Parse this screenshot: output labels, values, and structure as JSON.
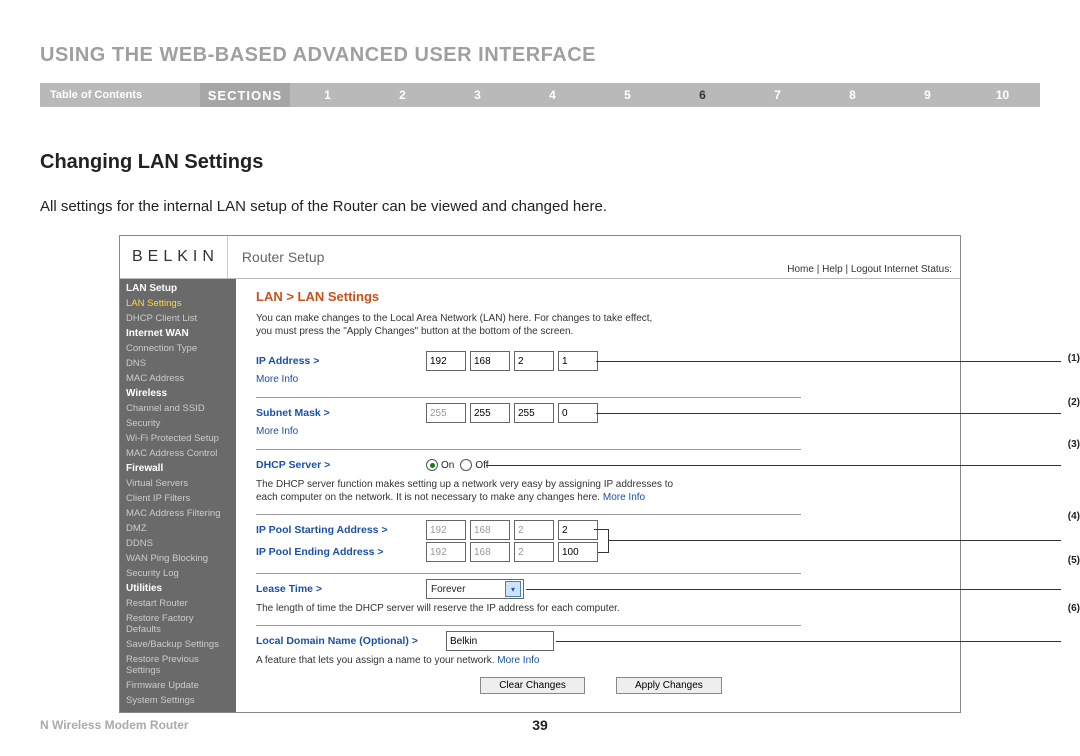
{
  "header": {
    "title": "USING THE WEB-BASED ADVANCED USER INTERFACE",
    "toc": "Table of Contents",
    "sections_label": "SECTIONS",
    "sections": [
      "1",
      "2",
      "3",
      "4",
      "5",
      "6",
      "7",
      "8",
      "9",
      "10"
    ],
    "active_section": "6"
  },
  "subhead": "Changing LAN Settings",
  "body_text": "All settings for the internal LAN setup of the Router can be viewed and changed here.",
  "ss": {
    "logo": "BELKIN",
    "router_setup": "Router Setup",
    "toplinks": "Home | Help | Logout   Internet Status:",
    "sidebar": [
      {
        "label": "LAN Setup",
        "type": "cat"
      },
      {
        "label": "LAN Settings",
        "type": "item",
        "active": true
      },
      {
        "label": "DHCP Client List",
        "type": "item"
      },
      {
        "label": "Internet WAN",
        "type": "cat"
      },
      {
        "label": "Connection Type",
        "type": "item"
      },
      {
        "label": "DNS",
        "type": "item"
      },
      {
        "label": "MAC Address",
        "type": "item"
      },
      {
        "label": "Wireless",
        "type": "cat"
      },
      {
        "label": "Channel and SSID",
        "type": "item"
      },
      {
        "label": "Security",
        "type": "item"
      },
      {
        "label": "Wi-Fi Protected Setup",
        "type": "item"
      },
      {
        "label": "MAC Address Control",
        "type": "item"
      },
      {
        "label": "Firewall",
        "type": "cat"
      },
      {
        "label": "Virtual Servers",
        "type": "item"
      },
      {
        "label": "Client IP Filters",
        "type": "item"
      },
      {
        "label": "MAC Address Filtering",
        "type": "item"
      },
      {
        "label": "DMZ",
        "type": "item"
      },
      {
        "label": "DDNS",
        "type": "item"
      },
      {
        "label": "WAN Ping Blocking",
        "type": "item"
      },
      {
        "label": "Security Log",
        "type": "item"
      },
      {
        "label": "Utilities",
        "type": "cat"
      },
      {
        "label": "Restart Router",
        "type": "item"
      },
      {
        "label": "Restore Factory Defaults",
        "type": "item"
      },
      {
        "label": "Save/Backup Settings",
        "type": "item"
      },
      {
        "label": "Restore Previous Settings",
        "type": "item"
      },
      {
        "label": "Firmware Update",
        "type": "item"
      },
      {
        "label": "System Settings",
        "type": "item"
      }
    ],
    "crumb": "LAN > LAN Settings",
    "intro": "You can make changes to the Local Area Network (LAN) here. For changes to take effect, you must press the \"Apply Changes\" button at the bottom of the screen.",
    "ip_label": "IP Address >",
    "ip": [
      "192",
      "168",
      "2",
      "1"
    ],
    "more_info": "More Info",
    "subnet_label": "Subnet Mask >",
    "subnet": [
      "255",
      "255",
      "255",
      "0"
    ],
    "dhcp_label": "DHCP Server >",
    "on": "On",
    "off": "Off",
    "dhcp_note1": "The DHCP server function makes setting up a network very easy by assigning IP addresses to each computer on the network. It is not necessary to make any changes here. ",
    "pool_start_label": "IP Pool Starting Address >",
    "pool_start": [
      "192",
      "168",
      "2",
      "2"
    ],
    "pool_end_label": "IP Pool Ending Address >",
    "pool_end": [
      "192",
      "168",
      "2",
      "100"
    ],
    "lease_label": "Lease Time >",
    "lease_value": "Forever",
    "lease_note": "The length of time the DHCP server will reserve the IP address for each computer.",
    "domain_label": "Local Domain Name  (Optional) >",
    "domain_value": "Belkin",
    "domain_note1": "A feature that lets you assign a name to your network. ",
    "clear": "Clear Changes",
    "apply": "Apply Changes",
    "callouts": [
      "(1)",
      "(2)",
      "(3)",
      "(4)",
      "(5)",
      "(6)"
    ]
  },
  "footer": {
    "name": "N Wireless Modem Router",
    "page": "39"
  }
}
